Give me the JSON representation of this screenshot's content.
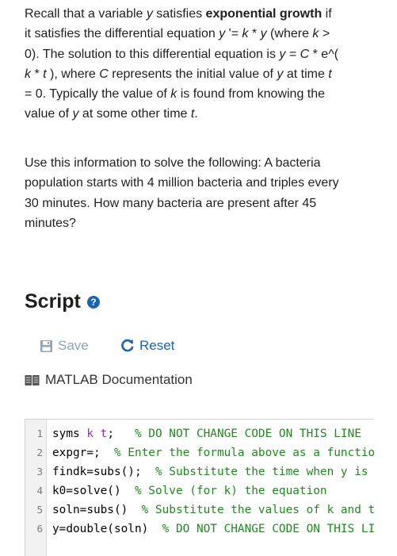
{
  "problem": {
    "p1": {
      "t1": "Recall that a variable ",
      "y1": "y",
      "t2": " satisfies ",
      "bold": "exponential growth",
      "t3": " if it satisfies the differential equation ",
      "y2": "y",
      "t4": " '= ",
      "k1": "k",
      "t5": " * ",
      "y3": "y",
      "t6": " (where ",
      "k2": "k",
      "t7": " > 0). The solution to this differential equation is ",
      "y4": "y",
      "t8": " = ",
      "C1": "C",
      "t9": " * e^( ",
      "k3": "k",
      "t10": " * ",
      "t_1": "t",
      "t11": " ), where ",
      "C2": "C",
      "t12": " represents the initial value of ",
      "y5": "y",
      "t13": " at time ",
      "t_2": "t",
      "t14": " = 0. Typically the value of ",
      "k4": "k",
      "t15": " is found from knowing the value of ",
      "y6": "y",
      "t16": " at some other time ",
      "t_3": "t",
      "t17": "."
    },
    "p2": "Use this information to solve the following: A bacteria population starts with 4 million bacteria and triples every 30 minutes. How many bacteria are present after 45 minutes?"
  },
  "script": {
    "title": "Script",
    "help_icon": "question-circle-icon",
    "save_label": "Save",
    "reset_label": "Reset",
    "doc_label": "MATLAB Documentation"
  },
  "editor": {
    "lines": [
      {
        "num": "1",
        "parts": [
          {
            "t": "syms ",
            "c": "kw"
          },
          {
            "t": "k t",
            "c": "var"
          },
          {
            "t": ";   ",
            "c": "kw"
          },
          {
            "t": "% DO NOT CHANGE CODE ON THIS LINE",
            "c": "cm"
          }
        ]
      },
      {
        "num": "2",
        "parts": [
          {
            "t": "expgr=;  ",
            "c": "kw"
          },
          {
            "t": "% Enter the formula above as a function of t",
            "c": "cm"
          }
        ]
      },
      {
        "num": "3",
        "parts": [
          {
            "t": "findk=subs();  ",
            "c": "kw"
          },
          {
            "t": "% Substitute the time when y is known",
            "c": "cm"
          }
        ]
      },
      {
        "num": "4",
        "parts": [
          {
            "t": "k0=solve()  ",
            "c": "kw"
          },
          {
            "t": "% Solve (for k) the equation",
            "c": "cm"
          }
        ]
      },
      {
        "num": "5",
        "parts": [
          {
            "t": "soln=subs()  ",
            "c": "kw"
          },
          {
            "t": "% Substitute the values of k and t",
            "c": "cm"
          }
        ]
      },
      {
        "num": "6",
        "parts": [
          {
            "t": "y=double(soln)  ",
            "c": "kw"
          },
          {
            "t": "% DO NOT CHANGE CODE ON THIS LINE",
            "c": "cm"
          }
        ]
      }
    ]
  }
}
